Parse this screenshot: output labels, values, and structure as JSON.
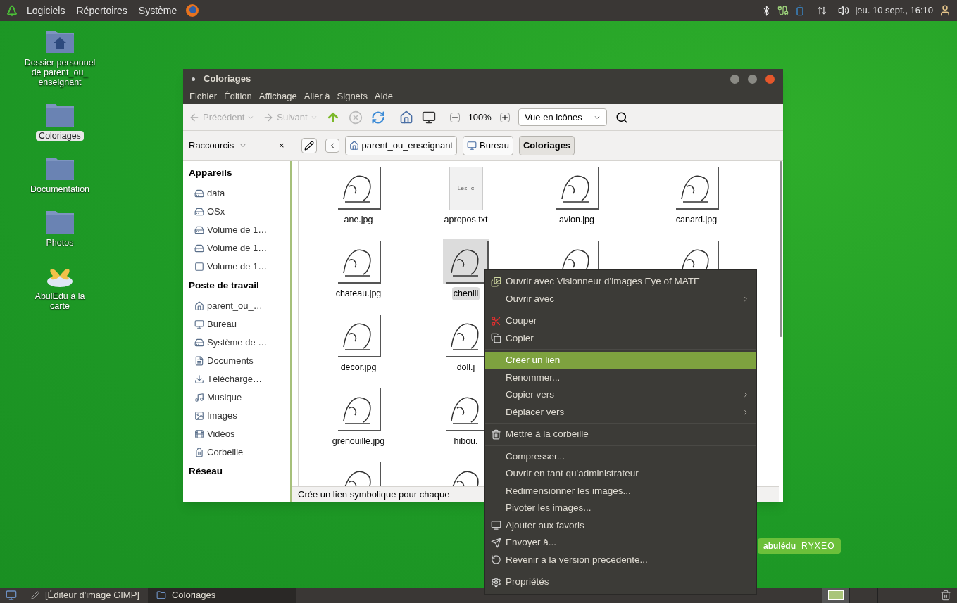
{
  "top_panel": {
    "menus": [
      "Logiciels",
      "Répertoires",
      "Système"
    ],
    "clock": "jeu. 10 sept., 16:10"
  },
  "desktop_icons": [
    {
      "label": "Dossier personnel de parent_ou_ enseignant",
      "kind": "home",
      "selected": false
    },
    {
      "label": "Coloriages",
      "kind": "folder",
      "selected": true
    },
    {
      "label": "Documentation",
      "kind": "folder",
      "selected": false
    },
    {
      "label": "Photos",
      "kind": "folder",
      "selected": false
    },
    {
      "label": "AbulEdu à la carte",
      "kind": "app",
      "selected": false
    }
  ],
  "window": {
    "title": "Coloriages",
    "menubar": [
      "Fichier",
      "Édition",
      "Affichage",
      "Aller à",
      "Signets",
      "Aide"
    ],
    "toolbar": {
      "back": {
        "label": "Précédent",
        "disabled": true
      },
      "forward": {
        "label": "Suivant",
        "disabled": true
      },
      "stop_disabled": true,
      "zoom": "100%",
      "view": "Vue en icônes"
    },
    "location": {
      "pane": "Raccourcis",
      "close": "×",
      "path": [
        {
          "label": "parent_ou_enseignant",
          "kind": "home",
          "selected": false
        },
        {
          "label": "Bureau",
          "kind": "desktop",
          "selected": false
        },
        {
          "label": "Coloriages",
          "kind": "folder",
          "selected": true
        }
      ]
    },
    "sidebar": [
      {
        "heading": "Appareils",
        "items": [
          {
            "label": "data",
            "kind": "drive"
          },
          {
            "label": "OSx",
            "kind": "drive"
          },
          {
            "label": "Volume de 1…",
            "kind": "drive"
          },
          {
            "label": "Volume de 1…",
            "kind": "drive"
          },
          {
            "label": "Volume de 1…",
            "kind": "disk"
          }
        ]
      },
      {
        "heading": "Poste de travail",
        "items": [
          {
            "label": "parent_ou_…",
            "kind": "home"
          },
          {
            "label": "Bureau",
            "kind": "desktop"
          },
          {
            "label": "Système de …",
            "kind": "drive"
          },
          {
            "label": "Documents",
            "kind": "document"
          },
          {
            "label": "Télécharge…",
            "kind": "download"
          },
          {
            "label": "Musique",
            "kind": "music"
          },
          {
            "label": "Images",
            "kind": "image"
          },
          {
            "label": "Vidéos",
            "kind": "video"
          },
          {
            "label": "Corbeille",
            "kind": "trash"
          }
        ]
      },
      {
        "heading": "Réseau"
      }
    ],
    "files": [
      [
        {
          "name": "ane.jpg",
          "kind": "image",
          "selected": false
        },
        {
          "name": "apropos.txt",
          "kind": "text",
          "preview": "Les c",
          "selected": false
        },
        {
          "name": "avion.jpg",
          "kind": "image",
          "selected": false
        },
        {
          "name": "canard.jpg",
          "kind": "image",
          "selected": false
        }
      ],
      [
        {
          "name": "chateau.jpg",
          "kind": "image",
          "selected": false
        },
        {
          "name": "chenill",
          "kind": "image",
          "selected": true
        },
        {
          "kind": "image"
        },
        {
          "kind": "image"
        }
      ],
      [
        {
          "name": "decor.jpg",
          "kind": "image",
          "selected": false
        },
        {
          "name": "doll.j",
          "kind": "image",
          "selected": false
        }
      ],
      [
        {
          "name": "grenouille.jpg",
          "kind": "image",
          "selected": false
        },
        {
          "name": "hibou.",
          "kind": "image",
          "selected": false
        }
      ],
      [
        {
          "kind": "image"
        },
        {
          "kind": "image"
        }
      ]
    ],
    "status": "Crée un lien symbolique pour chaque"
  },
  "context_menu": [
    {
      "kind": "item",
      "label": "Ouvrir avec Visionneur d'images Eye of MATE",
      "submenu": false,
      "selected": false
    },
    {
      "kind": "item",
      "label": "Ouvrir avec",
      "submenu": true,
      "selected": false
    },
    {
      "kind": "separator"
    },
    {
      "kind": "item",
      "label": "Couper",
      "submenu": false,
      "selected": false
    },
    {
      "kind": "item",
      "label": "Copier",
      "submenu": false,
      "selected": false
    },
    {
      "kind": "separator"
    },
    {
      "kind": "item",
      "label": "Créer un lien",
      "submenu": false,
      "selected": true
    },
    {
      "kind": "item",
      "label": "Renommer...",
      "submenu": false,
      "selected": false
    },
    {
      "kind": "item",
      "label": "Copier vers",
      "submenu": true,
      "selected": false
    },
    {
      "kind": "item",
      "label": "Déplacer vers",
      "submenu": true,
      "selected": false
    },
    {
      "kind": "separator"
    },
    {
      "kind": "item",
      "label": "Mettre à la corbeille",
      "submenu": false,
      "selected": false
    },
    {
      "kind": "separator"
    },
    {
      "kind": "item",
      "label": "Compresser...",
      "submenu": false,
      "selected": false
    },
    {
      "kind": "item",
      "label": "Ouvrir en tant qu'administrateur",
      "submenu": false,
      "selected": false
    },
    {
      "kind": "item",
      "label": "Redimensionner les images...",
      "submenu": false,
      "selected": false
    },
    {
      "kind": "item",
      "label": "Pivoter les images...",
      "submenu": false,
      "selected": false
    },
    {
      "kind": "item",
      "label": "Ajouter aux favoris",
      "submenu": false,
      "selected": false
    },
    {
      "kind": "item",
      "label": "Envoyer à...",
      "submenu": false,
      "selected": false
    },
    {
      "kind": "item",
      "label": "Revenir à la version précédente...",
      "submenu": false,
      "selected": false
    },
    {
      "kind": "separator"
    },
    {
      "kind": "item",
      "label": "Propriétés",
      "submenu": false,
      "selected": false
    }
  ],
  "logo": [
    "abulédu",
    "RYXEO"
  ],
  "taskbar": {
    "tasks": [
      {
        "label": "[Éditeur d'image GIMP]",
        "kind": "app",
        "selected": false
      },
      {
        "label": "Coloriages",
        "kind": "folder",
        "selected": true
      }
    ],
    "workspaces": [
      {
        "selected": true
      },
      {
        "selected": false
      },
      {
        "selected": false
      },
      {
        "selected": false
      }
    ]
  }
}
